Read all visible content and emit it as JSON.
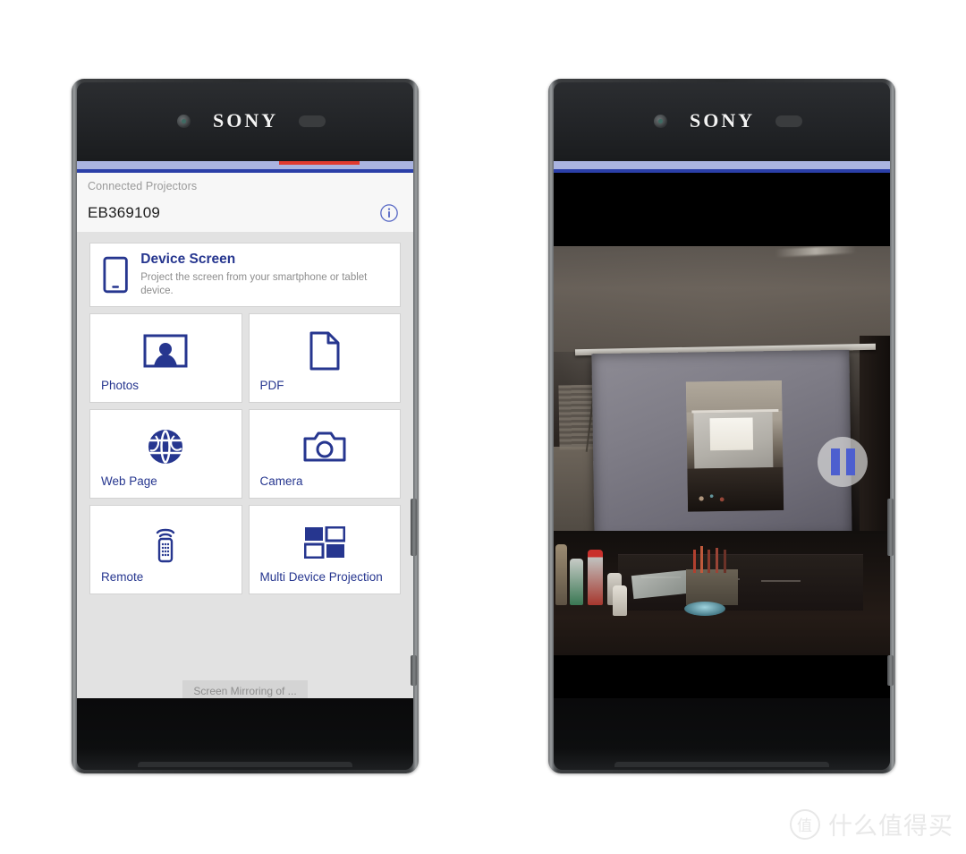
{
  "scene": {
    "description": "Two Sony Xperia Z5 smartphones side by side showing the Epson iProjection app",
    "device_brand": "SONY"
  },
  "theme": {
    "accent_blue": "#26368f",
    "bar_periwinkle": "#aab4e0",
    "bar_underline": "#2b3fa8",
    "bar_red": "#e03a2f",
    "app_bg": "#e2e2e2",
    "header_bg": "#f7f7f7",
    "tile_bg": "#ffffff",
    "pause_icon_blue": "#4d5fcf"
  },
  "phone_left": {
    "brand_label": "SONY",
    "app": {
      "header": {
        "section_label": "Connected Projectors",
        "projector_name": "EB369109",
        "info_icon": "info-circle-icon"
      },
      "tiles": [
        {
          "id": "device-screen",
          "icon": "smartphone-icon",
          "title": "Device Screen",
          "subtitle": "Project the screen from your smartphone or tablet device.",
          "layout": "wide"
        },
        {
          "id": "photos",
          "icon": "photo-portrait-icon",
          "label": "Photos",
          "layout": "square"
        },
        {
          "id": "pdf",
          "icon": "document-page-icon",
          "label": "PDF",
          "layout": "square"
        },
        {
          "id": "web-page",
          "icon": "globe-icon",
          "label": "Web Page",
          "layout": "square"
        },
        {
          "id": "camera",
          "icon": "camera-icon",
          "label": "Camera",
          "layout": "square"
        },
        {
          "id": "remote",
          "icon": "remote-control-icon",
          "label": "Remote",
          "layout": "square"
        },
        {
          "id": "multi-device-projection",
          "icon": "four-panes-icon",
          "label": "Multi Device Projection",
          "layout": "square"
        }
      ],
      "bottom_button_partial": "Screen Mirroring of ..."
    }
  },
  "phone_right": {
    "brand_label": "SONY",
    "app": {
      "mode": "photo-viewer",
      "photo_description": "Photo of a projector screen displaying a recursive image of the same room, with a cluttered desk in the dark foreground",
      "pause_icon": "pause-icon"
    }
  },
  "watermark": {
    "badge": "值",
    "text": "什么值得买"
  }
}
